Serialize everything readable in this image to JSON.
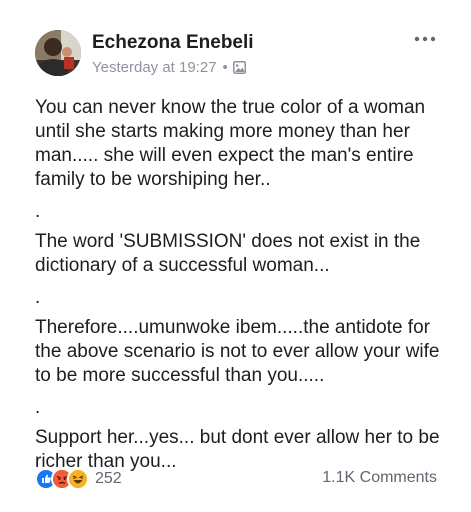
{
  "post": {
    "author": "Echezona Enebeli",
    "timestamp": "Yesterday at 19:27",
    "separator_dot": "•",
    "privacy_icon": "photo-privacy-icon",
    "paragraphs": [
      "You can never know the true color of a woman until she starts making more money than her man..... she will even expect the man's entire family to be worshiping her..",
      ".",
      "The word 'SUBMISSION' does not exist in the dictionary of a successful woman...",
      ".",
      "Therefore....umunwoke ibem.....the antidote for the above scenario is not to ever allow your wife to be more successful than you.....",
      ".",
      "Support her...yes... but dont ever allow her to be richer than you..."
    ]
  },
  "footer": {
    "reaction_icons": [
      "like-icon",
      "angry-icon",
      "haha-icon"
    ],
    "reaction_count": "252",
    "comments": "1.1K Comments"
  },
  "colors": {
    "text": "#1c1e21",
    "meta": "#8d949e",
    "footer_text": "#606770",
    "like_blue": "#1877f2",
    "angry_red": "#e9710f",
    "haha_yellow": "#f7b125"
  }
}
